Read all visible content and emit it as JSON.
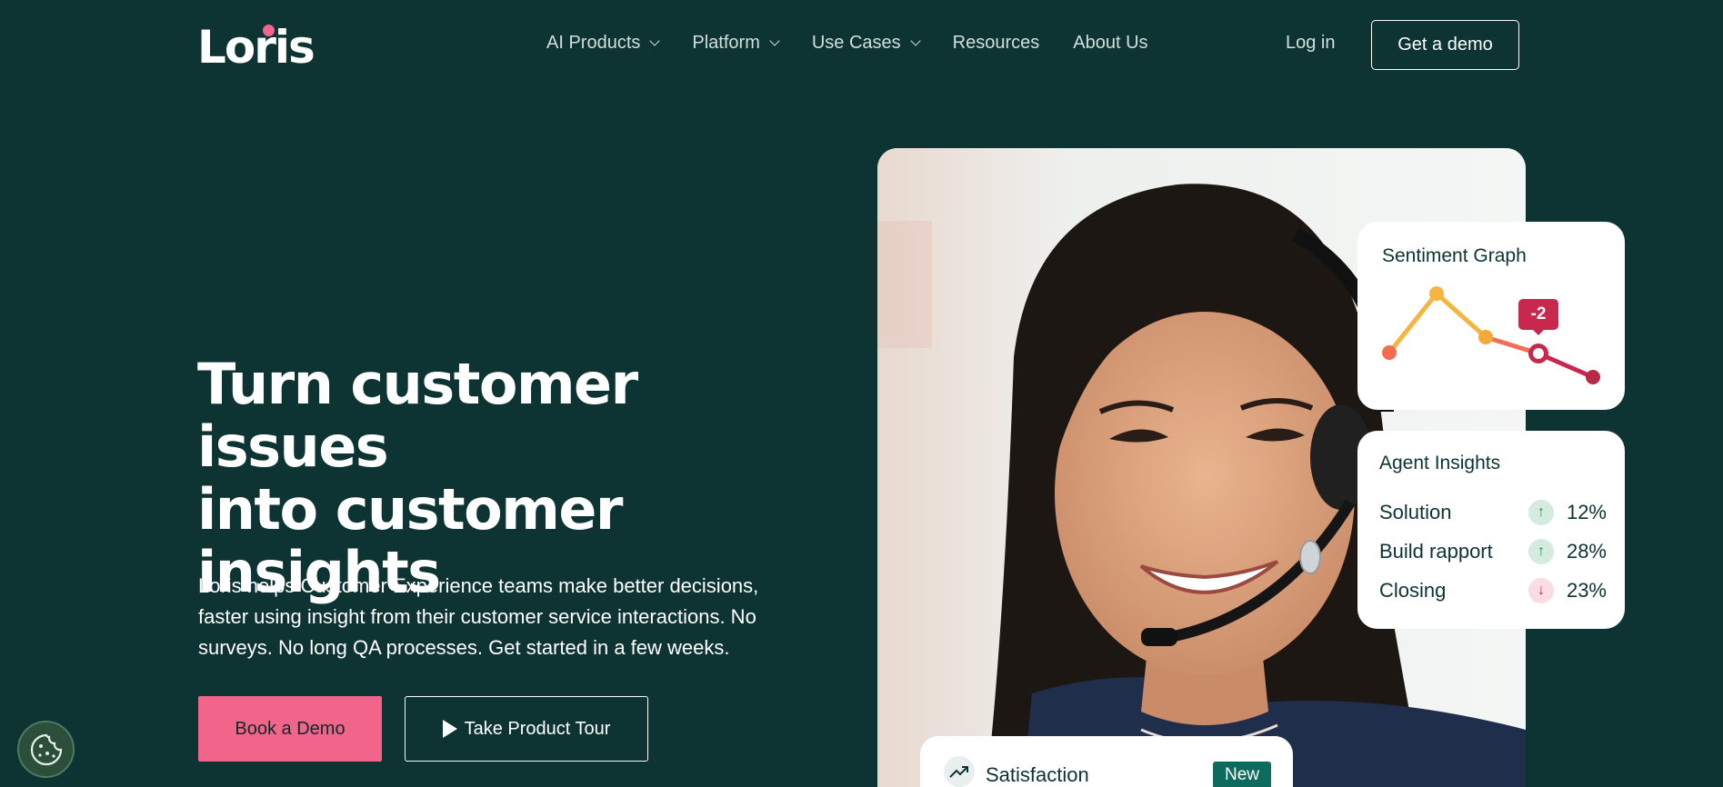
{
  "header": {
    "logo": "Loris",
    "nav": [
      {
        "label": "AI Products",
        "dropdown": true
      },
      {
        "label": "Platform",
        "dropdown": true
      },
      {
        "label": "Use Cases",
        "dropdown": true
      },
      {
        "label": "Resources",
        "dropdown": false
      },
      {
        "label": "About Us",
        "dropdown": false
      }
    ],
    "login_label": "Log in",
    "demo_label": "Get a demo"
  },
  "hero": {
    "title_lines": [
      "Turn customer issues",
      "into customer",
      "insights"
    ],
    "subtitle_lines": [
      "Loris helps Customer Experience teams make better decisions,",
      "faster using insight from their customer service interactions. No",
      "surveys. No long QA processes. Get started in a few weeks."
    ],
    "book_label": "Book a Demo",
    "tour_label": "Take Product Tour"
  },
  "sentiment_card": {
    "title": "Sentiment Graph",
    "badge": "-2"
  },
  "agent_card": {
    "title": "Agent Insights",
    "rows": [
      {
        "label": "Solution",
        "trend": "up",
        "value": "12%"
      },
      {
        "label": "Build rapport",
        "trend": "up",
        "value": "28%"
      },
      {
        "label": "Closing",
        "trend": "down",
        "value": "23%"
      }
    ]
  },
  "satisfaction_card": {
    "label": "Satisfaction",
    "badge": "New",
    "icon": "trend-up-icon"
  },
  "colors": {
    "background": "#0d3333",
    "accent_pink": "#f3648a",
    "negative": "#c8284d",
    "positive": "#1e8a5c"
  },
  "icons": {
    "cookie": "cookie-icon",
    "play": "play-icon",
    "chevron": "chevron-down-icon"
  }
}
